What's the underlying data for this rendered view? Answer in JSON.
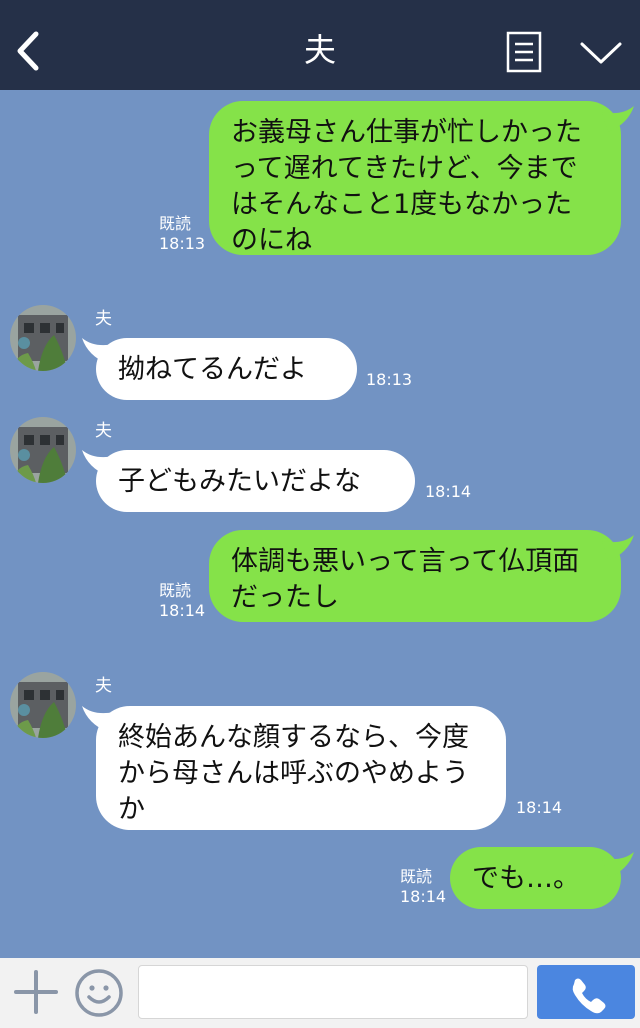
{
  "header": {
    "title": "夫",
    "back_icon": "chevron-left-icon",
    "menu_icon": "list-icon",
    "more_icon": "chevron-down-icon",
    "background": "#253048"
  },
  "chat": {
    "background": "#7293c3",
    "outgoing_bubble_color": "#85e249",
    "incoming_bubble_color": "#ffffff",
    "messages": [
      {
        "direction": "out",
        "text": "お義母さん仕事が忙しかったって遅れてきたけど、今まではそんなこと1度もなかったのにね",
        "read": "既読",
        "time": "18:13"
      },
      {
        "direction": "in",
        "sender": "夫",
        "text": "拗ねてるんだよ",
        "time": "18:13"
      },
      {
        "direction": "in",
        "sender": "夫",
        "text": "子どもみたいだよな",
        "time": "18:14"
      },
      {
        "direction": "out",
        "text": "体調も悪いって言って仏頂面だったし",
        "read": "既読",
        "time": "18:14"
      },
      {
        "direction": "in",
        "sender": "夫",
        "text": "終始あんな顔するなら、今度から母さんは呼ぶのやめようか",
        "time": "18:14"
      },
      {
        "direction": "out",
        "text": "でも…。",
        "read": "既読",
        "time": "18:14"
      }
    ]
  },
  "input_bar": {
    "plus_icon": "plus-icon",
    "sticker_icon": "smiley-icon",
    "input_value": "",
    "call_icon": "phone-icon",
    "call_color": "#4b86e0"
  }
}
